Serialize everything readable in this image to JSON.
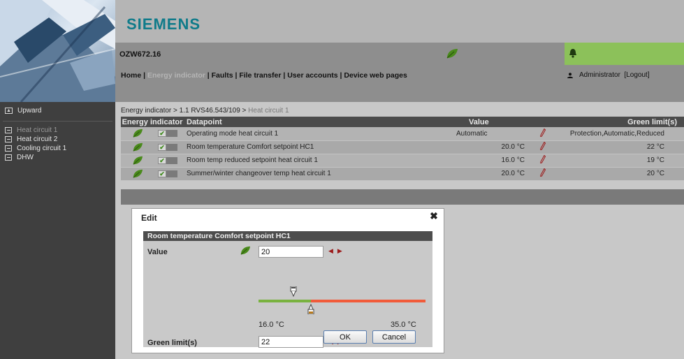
{
  "header": {
    "brand": "SIEMENS",
    "device_name": "OZW672.16",
    "menu": [
      {
        "label": "Home"
      },
      {
        "label": "Energy indicator",
        "active": true
      },
      {
        "label": "Faults"
      },
      {
        "label": "File transfer"
      },
      {
        "label": "User accounts"
      },
      {
        "label": "Device web pages"
      }
    ],
    "menu_separator": " | ",
    "user": "Administrator",
    "logout": "[Logout]"
  },
  "sidebar": {
    "upward": "Upward",
    "items": [
      {
        "label": "Heat circuit 1",
        "active": true
      },
      {
        "label": "Heat circuit 2"
      },
      {
        "label": "Cooling circuit 1"
      },
      {
        "label": "DHW"
      }
    ]
  },
  "breadcrumb": {
    "path": "Energy indicator > 1.1 RVS46.543/109 > ",
    "current": "Heat circuit 1"
  },
  "table": {
    "headers": {
      "energy_indicator": "Energy indicator",
      "datapoint": "Datapoint",
      "value": "Value",
      "green_limit": "Green limit(s)"
    },
    "rows": [
      {
        "datapoint": "Operating mode heat circuit 1",
        "value": "Automatic",
        "green_limit": "Protection,Automatic,Reduced",
        "checked": true
      },
      {
        "datapoint": "Room temperature Comfort setpoint HC1",
        "value": "20.0 °C",
        "green_limit": "22 °C",
        "checked": true
      },
      {
        "datapoint": "Room temp reduced setpoint heat circuit 1",
        "value": "16.0 °C",
        "green_limit": "19 °C",
        "checked": true
      },
      {
        "datapoint": "Summer/winter changeover temp heat circuit 1",
        "value": "20.0 °C",
        "green_limit": "20 °C",
        "checked": true
      }
    ]
  },
  "dialog": {
    "title": "Edit",
    "panel_title": "Room temperature Comfort setpoint HC1",
    "value_label": "Value",
    "value": "20",
    "green_limit_label": "Green limit(s)",
    "green_limit": "22",
    "range_min": "16.0 °C",
    "range_max": "35.0 °C",
    "min": 16.0,
    "max": 35.0,
    "ok": "OK",
    "cancel": "Cancel"
  },
  "colors": {
    "leaf": "#4a8a1c",
    "alarm_bg": "#8cc15a",
    "green_track": "#79b23f",
    "red_track": "#f15b3a",
    "brand": "#0f7b8a"
  },
  "icons": {
    "leaf": "leaf-icon",
    "bell": "bell-icon",
    "pencil": "pencil-icon",
    "close": "close-icon",
    "user": "user-icon"
  }
}
